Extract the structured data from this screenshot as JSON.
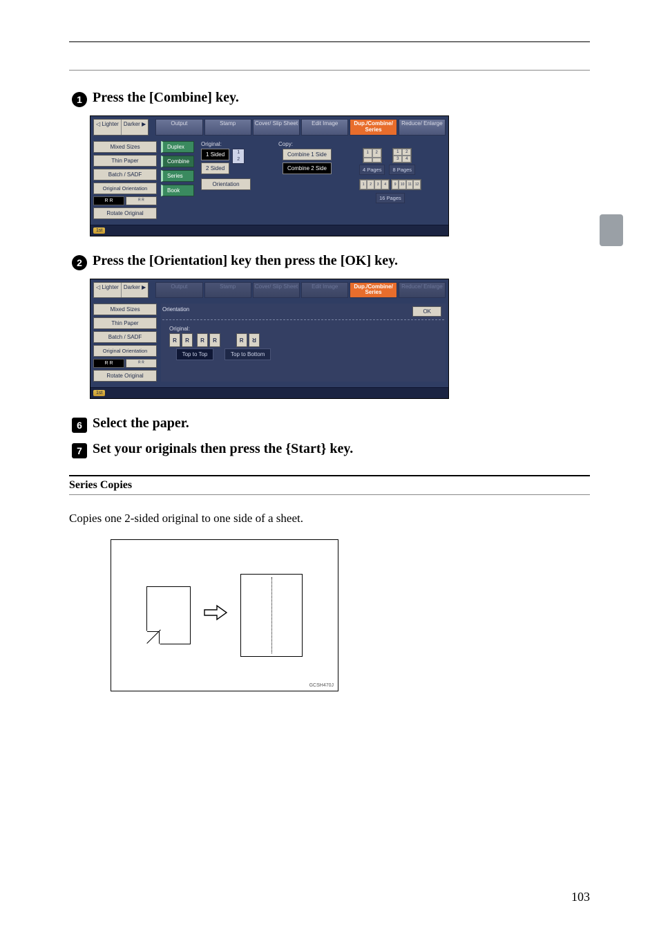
{
  "steps": {
    "s1_prefix": "Press the ",
    "s1_key": "[Combine]",
    "s1_suffix": " key.",
    "s2_prefix": "Press the ",
    "s2_key1": "[Orientation]",
    "s2_mid": " key then press the ",
    "s2_key2": "[OK]",
    "s2_suffix": " key.",
    "s6": "Select the paper.",
    "s7_prefix": "Set your originals then press the ",
    "s7_key": "{Start}",
    "s7_suffix": " key."
  },
  "panel1": {
    "lighter": "Lighter",
    "darker": "Darker",
    "tabs": [
      "Output",
      "Stamp",
      "Cover/\nSlip Sheet",
      "Edit\nImage",
      "Dup./Combine/\nSeries",
      "Reduce/\nEnlarge"
    ],
    "left": [
      "Mixed Sizes",
      "Thin Paper",
      "Batch / SADF",
      "Original Orientation",
      "Rotate Original"
    ],
    "mode": [
      "Duplex",
      "Combine",
      "Series",
      "Book"
    ],
    "orig_label": "Original:",
    "orig_opts": [
      "1 Sided",
      "2 Sided"
    ],
    "orientation_btn": "Orientation",
    "copy_label": "Copy:",
    "copy_opts": [
      "Combine 1 Side",
      "Combine 2 Side"
    ],
    "pages": [
      "4 Pages",
      "8 Pages",
      "16 Pages"
    ],
    "footer": "1st"
  },
  "panel2": {
    "orientation": "Orientation",
    "original": "Original:",
    "ok": "OK",
    "top_to_top": "Top to Top",
    "top_to_bottom": "Top to Bottom"
  },
  "series": {
    "title": "Series Copies",
    "desc": "Copies one 2-sided original to one side of a sheet.",
    "diagram_id": "GCSH470J"
  },
  "pagenum": "103"
}
